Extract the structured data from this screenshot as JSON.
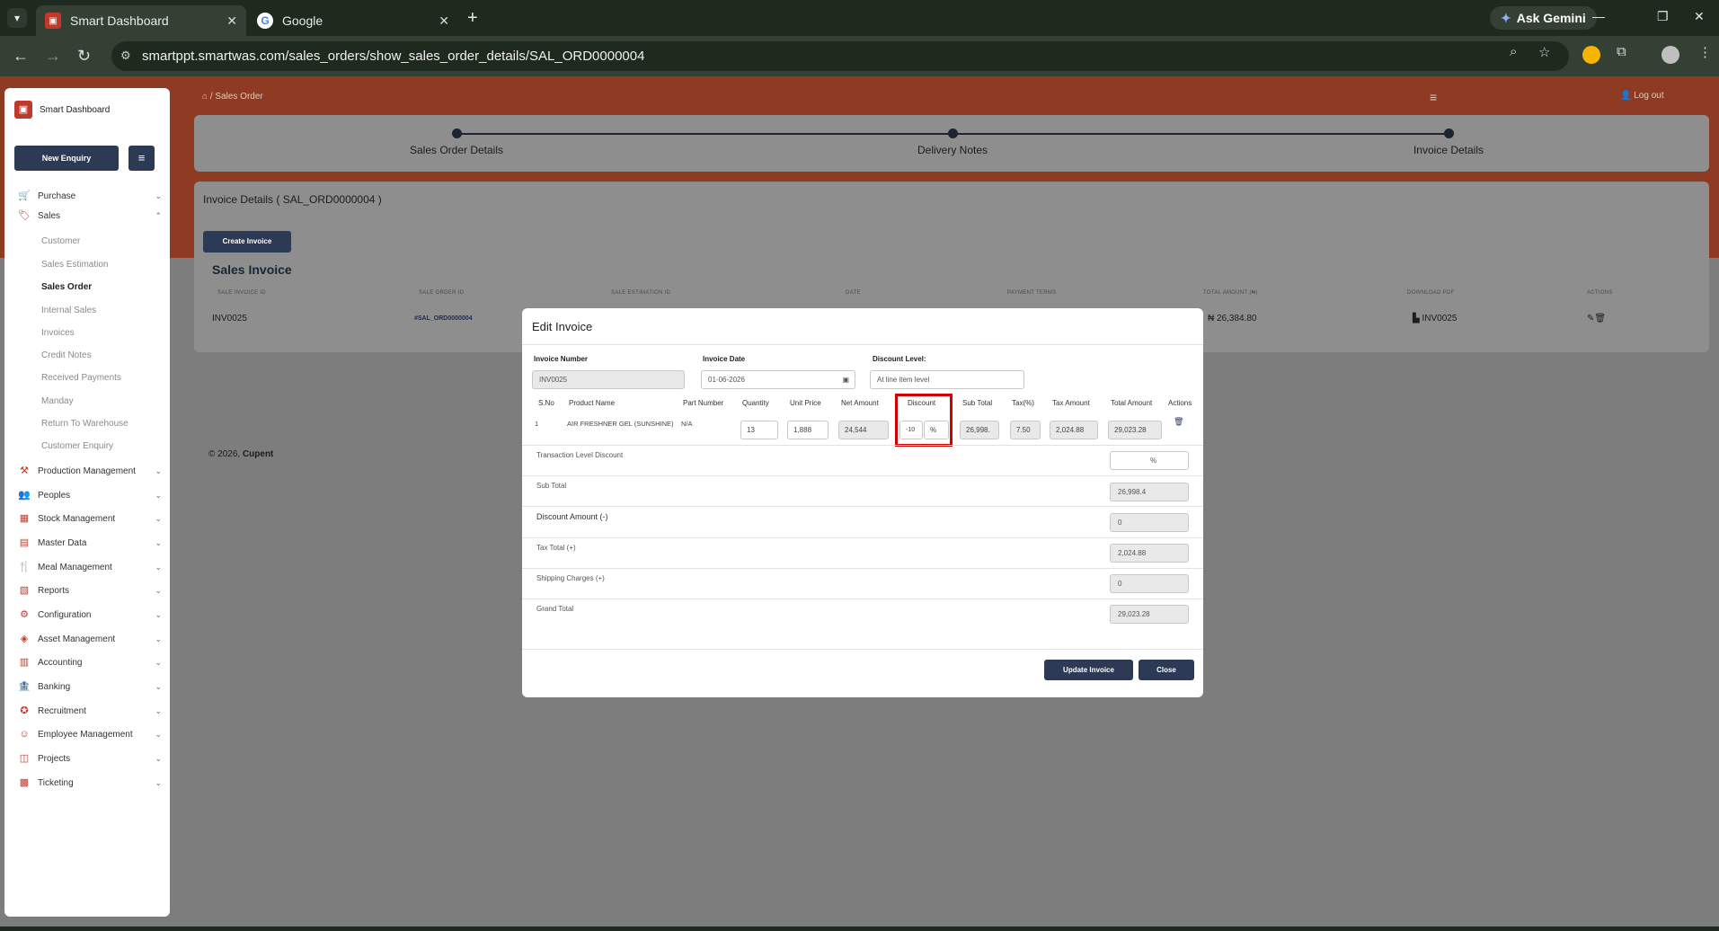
{
  "browser": {
    "tabs": [
      {
        "title": "Smart Dashboard",
        "active": true,
        "icon": "dashboard-favicon"
      },
      {
        "title": "Google",
        "active": false,
        "icon": "google-favicon"
      }
    ],
    "gemini_label": "Ask Gemini",
    "url": "smartppt.smartwas.com/sales_orders/show_sales_order_details/SAL_ORD0000004"
  },
  "sidebar": {
    "brand": "Smart Dashboard",
    "new_enquiry": "New Enquiry",
    "items": [
      {
        "label": "Purchase",
        "icon": "cart-icon"
      },
      {
        "label": "Sales",
        "icon": "sales-icon"
      },
      {
        "label": "Production Management",
        "icon": "factory-icon"
      },
      {
        "label": "Peoples",
        "icon": "people-icon"
      },
      {
        "label": "Stock Management",
        "icon": "box-icon"
      },
      {
        "label": "Master Data",
        "icon": "database-icon"
      },
      {
        "label": "Meal Management",
        "icon": "meal-icon"
      },
      {
        "label": "Reports",
        "icon": "report-icon"
      },
      {
        "label": "Configuration",
        "icon": "config-icon"
      },
      {
        "label": "Asset Management",
        "icon": "asset-icon"
      },
      {
        "label": "Accounting",
        "icon": "accounting-icon"
      },
      {
        "label": "Banking",
        "icon": "bank-icon"
      },
      {
        "label": "Recruitment",
        "icon": "recruit-icon"
      },
      {
        "label": "Employee Management",
        "icon": "employee-icon"
      },
      {
        "label": "Projects",
        "icon": "project-icon"
      },
      {
        "label": "Ticketing",
        "icon": "ticket-icon"
      }
    ],
    "sales_sub": [
      "Customer",
      "Sales Estimation",
      "Sales Order",
      "Internal Sales",
      "Invoices",
      "Credit Notes",
      "Received Payments",
      "Manday",
      "Return To Warehouse",
      "Customer Enquiry"
    ]
  },
  "header": {
    "breadcrumb": "Sales Order",
    "logout": "Log out"
  },
  "stepper": [
    "Sales Order Details",
    "Delivery Notes",
    "Invoice Details"
  ],
  "content": {
    "title": "Invoice Details ( SAL_ORD0000004 )",
    "create_invoice": "Create Invoice",
    "table_title": "Sales Invoice",
    "columns": [
      "SALE INVOICE ID",
      "SALE ORDER ID",
      "SALE ESTIMATION ID",
      "DATE",
      "PAYMENT TERMS",
      "TOTAL AMOUNT (₦)",
      "DOWNLOAD PDF",
      "ACTIONS"
    ],
    "row": {
      "invoice_id": "INV0025",
      "order_id": "#SAL_ORD0000004",
      "total": "₦ 26,384.80",
      "pdf": "INV0025"
    },
    "footer_prefix": "© 2026,",
    "footer_brand": "Cupent"
  },
  "modal": {
    "title": "Edit Invoice",
    "invoice_number_label": "Invoice Number",
    "invoice_number": "INV0025",
    "invoice_date_label": "Invoice Date",
    "invoice_date": "01-06-2026",
    "discount_level_label": "Discount Level:",
    "discount_level": "At line item level",
    "columns": [
      "S.No",
      "Product Name",
      "Part Number",
      "Quantity",
      "Unit Price",
      "Net Amount",
      "Discount",
      "Sub Total",
      "Tax(%)",
      "Tax Amount",
      "Total Amount",
      "Actions"
    ],
    "line": {
      "sno": "1",
      "product": "AIR FRESHNER GEL (SUNSHINE)",
      "part": "N/A",
      "qty": "13",
      "unit_price": "1,888",
      "net_amount": "24,544",
      "discount": "-10",
      "discount_unit": "%",
      "sub_total": "26,998.",
      "tax": "7.50",
      "tax_amount": "2,024.88",
      "total": "29,023.28"
    },
    "summary": [
      {
        "label": "Transaction Level Discount",
        "value": "%"
      },
      {
        "label": "Sub Total",
        "value": "26,998.4"
      },
      {
        "label": "Discount Amount (-)",
        "value": "0"
      },
      {
        "label": "Tax Total (+)",
        "value": "2,024.88"
      },
      {
        "label": "Shipping Charges (+)",
        "value": "0"
      },
      {
        "label": "Grand Total",
        "value": "29,023.28"
      }
    ],
    "update_btn": "Update Invoice",
    "close_btn": "Close"
  }
}
